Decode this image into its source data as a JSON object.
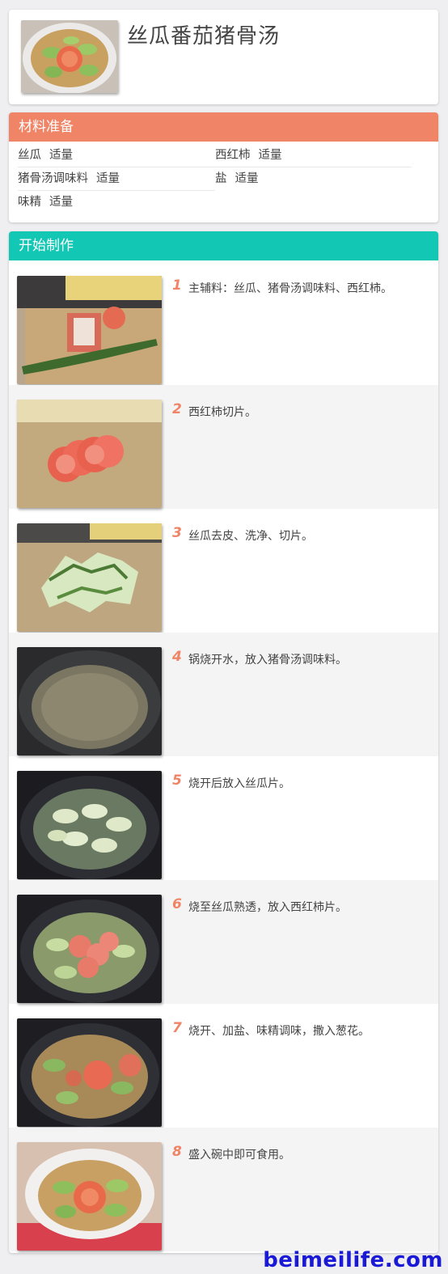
{
  "recipe": {
    "title": "丝瓜番茄猪骨汤"
  },
  "ingredients": {
    "heading": "材料准备",
    "items": [
      {
        "name": "丝瓜",
        "amount": "适量"
      },
      {
        "name": "西红柿",
        "amount": "适量"
      },
      {
        "name": "猪骨汤调味料",
        "amount": "适量"
      },
      {
        "name": "盐",
        "amount": "适量"
      },
      {
        "name": "味精",
        "amount": "适量"
      }
    ]
  },
  "steps": {
    "heading": "开始制作",
    "items": [
      {
        "num": "1",
        "text": "主辅料：丝瓜、猪骨汤调味料、西红柿。"
      },
      {
        "num": "2",
        "text": "西红柿切片。"
      },
      {
        "num": "3",
        "text": "丝瓜去皮、洗净、切片。"
      },
      {
        "num": "4",
        "text": "锅烧开水，放入猪骨汤调味料。"
      },
      {
        "num": "5",
        "text": "烧开后放入丝瓜片。"
      },
      {
        "num": "6",
        "text": "烧至丝瓜熟透，放入西红柿片。"
      },
      {
        "num": "7",
        "text": "烧开、加盐、味精调味，撒入葱花。"
      },
      {
        "num": "8",
        "text": "盛入碗中即可食用。"
      }
    ]
  },
  "watermark": "beimeilife.com"
}
